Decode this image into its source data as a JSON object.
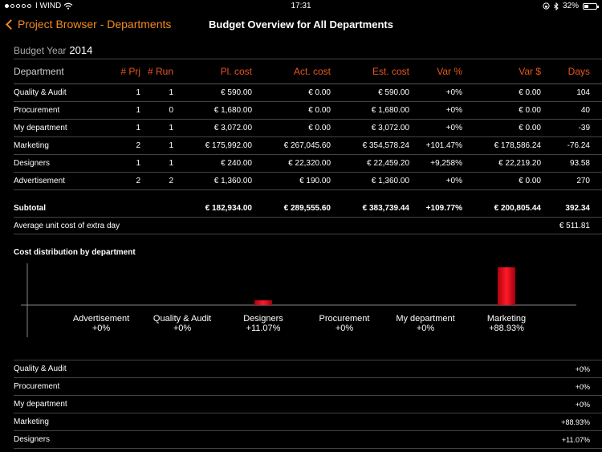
{
  "status": {
    "carrier": "I WIND",
    "time": "17:31",
    "battery": "32%",
    "battery_level": 0.32,
    "signal_bars_filled": 1,
    "signal_bars_total": 5
  },
  "nav": {
    "back_label": "Project Browser - Departments",
    "title": "Budget Overview for All Departments"
  },
  "budget": {
    "label": "Budget Year",
    "year": "2014"
  },
  "table": {
    "headers": {
      "department": "Department",
      "prj": "# Prj",
      "run": "# Run",
      "pl_cost": "Pl. cost",
      "act_cost": "Act. cost",
      "est_cost": "Est. cost",
      "var_pct": "Var %",
      "var_abs": "Var $",
      "days": "Days"
    },
    "rows": [
      {
        "department": "Quality & Audit",
        "prj": "1",
        "run": "1",
        "pl_cost": "€ 590.00",
        "act_cost": "€ 0.00",
        "est_cost": "€ 590.00",
        "var_pct": "+0%",
        "var_abs": "€ 0.00",
        "days": "104"
      },
      {
        "department": "Procurement",
        "prj": "1",
        "run": "0",
        "pl_cost": "€ 1,680.00",
        "act_cost": "€ 0.00",
        "est_cost": "€ 1,680.00",
        "var_pct": "+0%",
        "var_abs": "€ 0.00",
        "days": "40"
      },
      {
        "department": "My department",
        "prj": "1",
        "run": "1",
        "pl_cost": "€ 3,072.00",
        "act_cost": "€ 0.00",
        "est_cost": "€ 3,072.00",
        "var_pct": "+0%",
        "var_abs": "€ 0.00",
        "days": "-39"
      },
      {
        "department": "Marketing",
        "prj": "2",
        "run": "1",
        "pl_cost": "€ 175,992.00",
        "act_cost": "€ 267,045.60",
        "est_cost": "€ 354,578.24",
        "var_pct": "+101.47%",
        "var_abs": "€ 178,586.24",
        "days": "-76.24"
      },
      {
        "department": "Designers",
        "prj": "1",
        "run": "1",
        "pl_cost": "€ 240.00",
        "act_cost": "€ 22,320.00",
        "est_cost": "€ 22,459.20",
        "var_pct": "+9,258%",
        "var_abs": "€ 22,219.20",
        "days": "93.58"
      },
      {
        "department": "Advertisement",
        "prj": "2",
        "run": "2",
        "pl_cost": "€ 1,360.00",
        "act_cost": "€ 190.00",
        "est_cost": "€ 1,360.00",
        "var_pct": "+0%",
        "var_abs": "€ 0.00",
        "days": "270"
      }
    ],
    "subtotal": {
      "department": "Subtotal",
      "pl_cost": "€ 182,934.00",
      "act_cost": "€ 289,555.60",
      "est_cost": "€ 383,739.44",
      "var_pct": "+109.77%",
      "var_abs": "€ 200,805.44",
      "days": "392.34"
    },
    "avg": {
      "label": "Average unit cost of extra day",
      "value": "€ 511.81"
    }
  },
  "chart_data": {
    "type": "bar",
    "title": "Cost distribution by department",
    "categories": [
      "Advertisement",
      "Quality & Audit",
      "Designers",
      "Procurement",
      "My department",
      "Marketing"
    ],
    "values": [
      0,
      0,
      11.07,
      0,
      0,
      88.93
    ],
    "value_labels": [
      "+0%",
      "+0%",
      "+11.07%",
      "+0%",
      "+0%",
      "+88.93%"
    ],
    "ylim": [
      0,
      100
    ],
    "color": "#e8101e"
  },
  "distribution": [
    {
      "label": "Quality & Audit",
      "value": "+0%"
    },
    {
      "label": "Procurement",
      "value": "+0%"
    },
    {
      "label": "My department",
      "value": "+0%"
    },
    {
      "label": "Marketing",
      "value": "+88.93%"
    },
    {
      "label": "Designers",
      "value": "+11.07%"
    }
  ]
}
